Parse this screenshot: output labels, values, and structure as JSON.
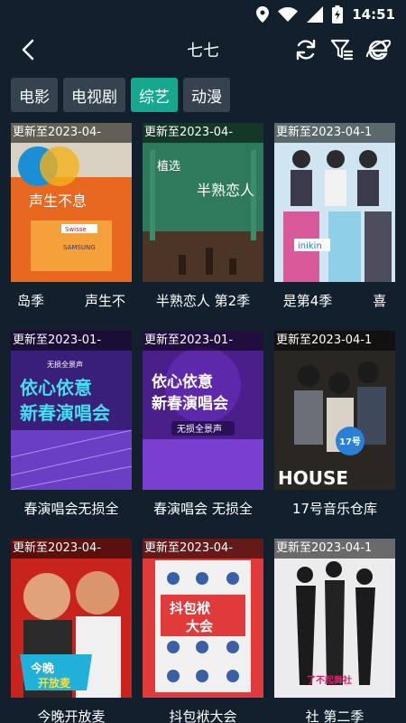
{
  "status_bar": {
    "time": "14:51"
  },
  "header": {
    "title": "七七"
  },
  "tabs": [
    {
      "label": "电影",
      "active": false
    },
    {
      "label": "电视剧",
      "active": false
    },
    {
      "label": "综艺",
      "active": true
    },
    {
      "label": "动漫",
      "active": false
    }
  ],
  "cards": [
    {
      "update": "更新至2023-04-",
      "title": "岛季　　　声生不",
      "poster_texts": [
        "声生不息",
        "Swisse",
        "SAMSUNG"
      ]
    },
    {
      "update": "更新至2023-04-",
      "title": "半熟恋人 第2季",
      "poster_texts": [
        "植选",
        "半熟恋人"
      ]
    },
    {
      "update": "更新至2023-04-1",
      "title": "是第4季　　　喜",
      "poster_texts": [
        "inikin"
      ]
    },
    {
      "update": "更新至2023-01-",
      "title": "春演唱会无损全",
      "poster_texts": [
        "无损全景声",
        "依心依意",
        "新春演唱会"
      ]
    },
    {
      "update": "更新至2023-01-",
      "title": "春演唱会 无损全",
      "poster_texts": [
        "依心依意",
        "新春演唱会",
        "无损全景声"
      ]
    },
    {
      "update": "更新至2023-04-1",
      "title": "17号音乐仓库",
      "poster_texts": [
        "17号",
        "HOUSE"
      ]
    },
    {
      "update": "更新至2023-04-",
      "title": "今晚开放麦",
      "poster_texts": [
        "今晚",
        "开放麦"
      ]
    },
    {
      "update": "更新至2023-04-",
      "title": "抖包袱大会",
      "poster_texts": [
        "抖包袱",
        "大会"
      ]
    },
    {
      "update": "更新至2023-04-1",
      "title": "社 第二季",
      "poster_texts": [
        "了不起舞社"
      ]
    }
  ],
  "colors": {
    "background": "#12202d",
    "tab": "#36424d",
    "tab_active": "#15a88f"
  }
}
